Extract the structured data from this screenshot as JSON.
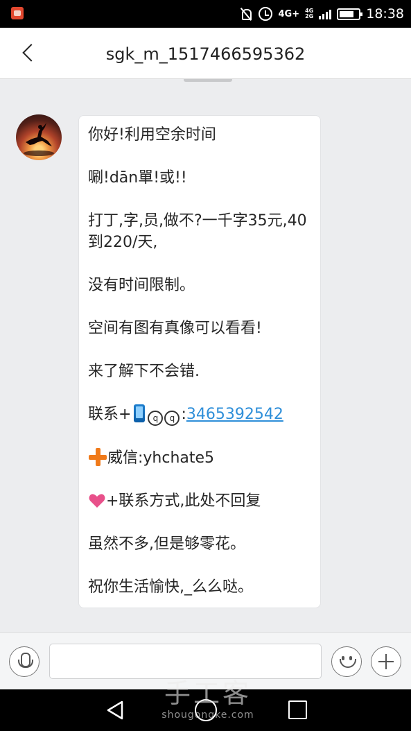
{
  "status_bar": {
    "network_label": "4G+",
    "network_secondary_top": "4G",
    "network_secondary_bottom": "2G",
    "time": "18:38"
  },
  "header": {
    "title": "sgk_m_1517466595362"
  },
  "message": {
    "line1": "你好!利用空余时间",
    "line2": "唰!dān單!或!!",
    "line3": "打丁,字,员,做不?一千字35元,40到220/天,",
    "line4": "没有时间限制。",
    "line5": "空间有图有真像可以看看!",
    "line6": "来了解下不会错.",
    "contact_prefix": "联系+",
    "q1": "q",
    "q2": "q",
    "qq_colon": ":",
    "qq_number": "3465392542",
    "wechat": "威信:yhchate5",
    "note": "+联系方式,此处不回复",
    "line10": "虽然不多,但是够零花。",
    "line11": "祝你生活愉快,_么么哒。"
  },
  "watermark": {
    "text": "手工客",
    "sub": "shougongke.com"
  },
  "colors": {
    "link": "#2f8fd9",
    "plus_accent": "#f07a1a",
    "heart": "#e8508a"
  },
  "icons": [
    "back-icon",
    "mic-icon",
    "emoji-icon",
    "add-icon",
    "phone-icon",
    "plus-icon",
    "heart-icon"
  ]
}
